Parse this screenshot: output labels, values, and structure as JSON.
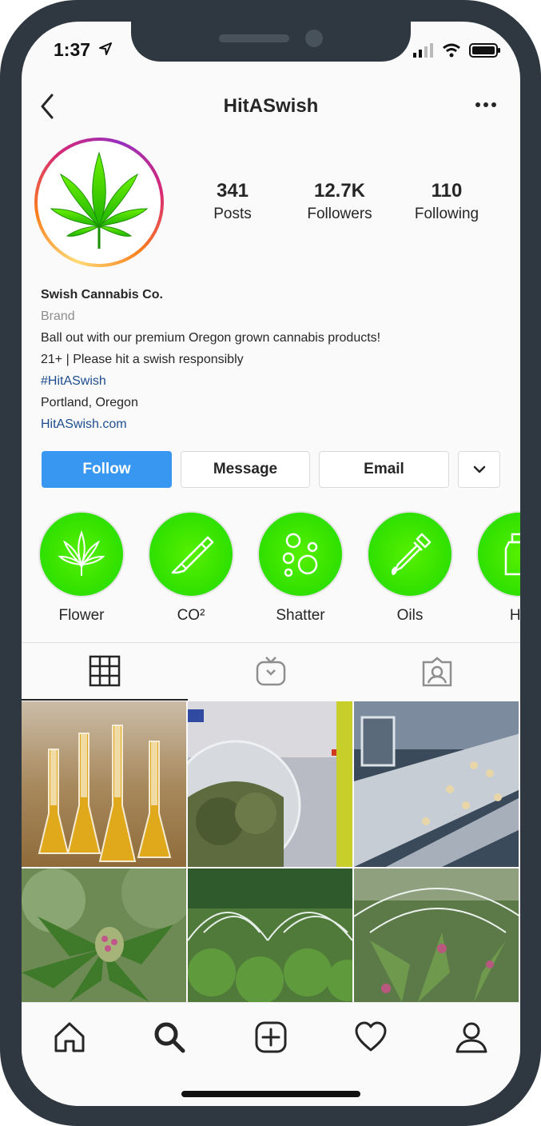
{
  "status_bar": {
    "time": "1:37"
  },
  "header": {
    "title": "HitASwish"
  },
  "profile": {
    "stats": [
      {
        "value": "341",
        "label": "Posts"
      },
      {
        "value": "12.7K",
        "label": "Followers"
      },
      {
        "value": "110",
        "label": "Following"
      }
    ],
    "name": "Swish Cannabis Co.",
    "category": "Brand",
    "bio_line1": "Ball out with our premium Oregon grown cannabis products!",
    "bio_line2": "21+ | Please hit a swish responsibly",
    "hashtag": "#HitASwish",
    "location": "Portland, Oregon",
    "website": "HitASwish.com"
  },
  "actions": {
    "follow": "Follow",
    "message": "Message",
    "email": "Email"
  },
  "highlights": [
    {
      "label": "Flower",
      "icon": "leaf-icon"
    },
    {
      "label": "CO²",
      "icon": "vape-pen-icon"
    },
    {
      "label": "Shatter",
      "icon": "bubbles-icon"
    },
    {
      "label": "Oils",
      "icon": "dropper-icon"
    },
    {
      "label": "He",
      "icon": "bottle-icon"
    }
  ],
  "tabs": [
    "grid-icon",
    "igtv-icon",
    "tagged-icon"
  ],
  "grid_posts": [
    "lab-flasks-oil",
    "glass-flask-flower",
    "machinery",
    "cannabis-plant-closeup",
    "greenhouse-rows",
    "greenhouse-hoops"
  ],
  "bottom_nav": [
    "home-icon",
    "search-icon",
    "add-post-icon",
    "heart-icon",
    "profile-icon"
  ],
  "colors": {
    "follow": "#3897f0",
    "highlight": "#3be300",
    "link": "#1e4d8f",
    "frame": "#2f3840"
  }
}
